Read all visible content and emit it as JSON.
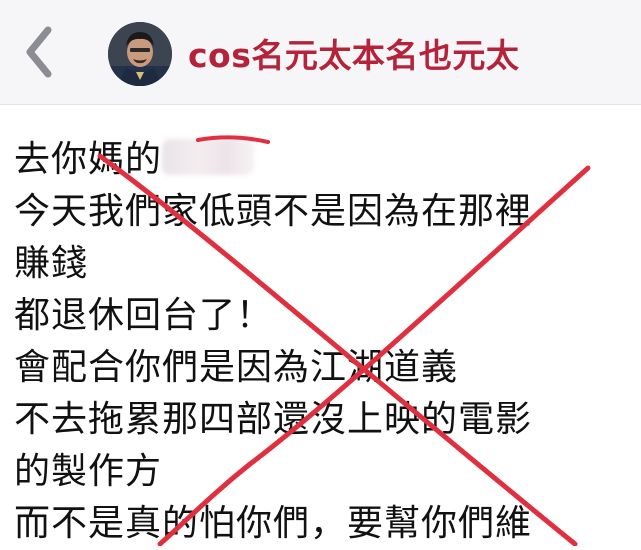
{
  "header": {
    "title": "cos名元太本名也元太",
    "back_icon": "chevron-left-icon",
    "avatar_icon": "profile-avatar"
  },
  "post": {
    "lines": [
      "去你媽的",
      "今天我們家低頭不是因為在那裡",
      "賺錢",
      "都退休回台了！",
      "會配合你們是因為江湖道義",
      "不去拖累那四部還沒上映的電影",
      "的製作方",
      "而不是真的怕你們，要幫你們維"
    ]
  },
  "overlay": {
    "cross_color": "#e0303f"
  },
  "colors": {
    "header_bg": "#f6f6f8",
    "title": "#b5233a",
    "text": "#111111"
  }
}
